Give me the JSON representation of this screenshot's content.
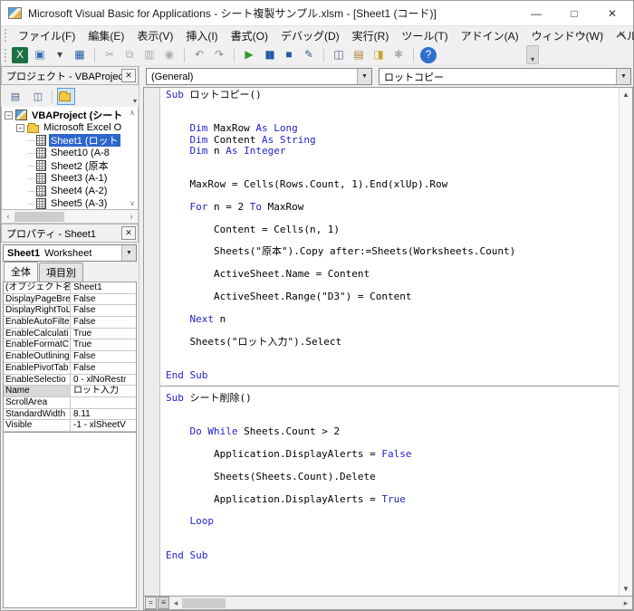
{
  "titlebar": {
    "title": "Microsoft Visual Basic for Applications - シート複製サンプル.xlsm - [Sheet1 (コード)]"
  },
  "menubar": {
    "items": [
      "ファイル(F)",
      "編集(E)",
      "表示(V)",
      "挿入(I)",
      "書式(O)",
      "デバッグ(D)",
      "実行(R)",
      "ツール(T)",
      "アドイン(A)",
      "ウィンドウ(W)",
      "ヘルプ(H)"
    ]
  },
  "toolbar": {
    "buttons": [
      {
        "name": "view-excel",
        "glyph": "X",
        "fg": "#ffffff",
        "bg": "#1d7044"
      },
      {
        "name": "insert-userform",
        "glyph": "▣",
        "fg": "#3b6bb5"
      },
      {
        "name": "insert-dropdown",
        "glyph": "▾",
        "fg": "#444444"
      },
      {
        "name": "save",
        "glyph": "▦",
        "fg": "#2456a8"
      },
      {
        "name": "separator"
      },
      {
        "name": "cut",
        "glyph": "✂",
        "fg": "#9a9a9a",
        "disabled": true
      },
      {
        "name": "copy",
        "glyph": "⧉",
        "fg": "#9a9a9a",
        "disabled": true
      },
      {
        "name": "paste",
        "glyph": "▥",
        "fg": "#9a9a9a",
        "disabled": true
      },
      {
        "name": "find",
        "glyph": "◉",
        "fg": "#9a9a9a",
        "disabled": true
      },
      {
        "name": "separator"
      },
      {
        "name": "undo",
        "glyph": "↶",
        "fg": "#8a8a8a"
      },
      {
        "name": "redo",
        "glyph": "↷",
        "fg": "#8a8a8a"
      },
      {
        "name": "separator"
      },
      {
        "name": "run",
        "glyph": "▶",
        "fg": "#2d9a2d"
      },
      {
        "name": "break",
        "glyph": "▮▮",
        "fg": "#2456a8"
      },
      {
        "name": "reset",
        "glyph": "■",
        "fg": "#2456a8"
      },
      {
        "name": "design-mode",
        "glyph": "✎",
        "fg": "#46628c"
      },
      {
        "name": "separator"
      },
      {
        "name": "project-explorer",
        "glyph": "◫",
        "fg": "#46628c"
      },
      {
        "name": "properties-window",
        "glyph": "▤",
        "fg": "#b07a3c"
      },
      {
        "name": "object-browser",
        "glyph": "◨",
        "fg": "#c9a227"
      },
      {
        "name": "toolbox",
        "glyph": "✱",
        "fg": "#9a9a9a",
        "disabled": true
      },
      {
        "name": "separator"
      },
      {
        "name": "help",
        "glyph": "?",
        "fg": "#ffffff",
        "bg": "#2f6fd0",
        "round": true
      }
    ]
  },
  "project": {
    "caption": "プロジェクト - VBAProject",
    "toolbar": [
      {
        "name": "view-code",
        "glyph": "▤",
        "fg": "#46628c"
      },
      {
        "name": "view-object",
        "glyph": "◫",
        "fg": "#46628c"
      },
      {
        "name": "separator"
      },
      {
        "name": "toggle-folders",
        "css": "folder",
        "pressed": true
      }
    ],
    "tree": [
      {
        "label": "VBAProject (シート",
        "level": 0,
        "bold": true,
        "expander": true,
        "icon": "vbaproject"
      },
      {
        "label": "Microsoft Excel O",
        "level": 1,
        "expander": true,
        "icon": "folder"
      },
      {
        "label": "Sheet1 (ロット",
        "level": 2,
        "icon": "sheet",
        "selected": true
      },
      {
        "label": "Sheet10 (A-8",
        "level": 2,
        "icon": "sheet"
      },
      {
        "label": "Sheet2 (原本",
        "level": 2,
        "icon": "sheet"
      },
      {
        "label": "Sheet3 (A-1)",
        "level": 2,
        "icon": "sheet"
      },
      {
        "label": "Sheet4 (A-2)",
        "level": 2,
        "icon": "sheet"
      },
      {
        "label": "Sheet5 (A-3)",
        "level": 2,
        "icon": "sheet"
      }
    ]
  },
  "properties": {
    "caption": "プロパティ - Sheet1",
    "object": {
      "name": "Sheet1",
      "type": "Worksheet"
    },
    "tabs": [
      "全体",
      "項目別"
    ],
    "active_tab": "全体",
    "rows": [
      {
        "label": "(オブジェクト名)",
        "value": "Sheet1"
      },
      {
        "label": "DisplayPageBre",
        "value": "False"
      },
      {
        "label": "DisplayRightToL",
        "value": "False"
      },
      {
        "label": "EnableAutoFilte",
        "value": "False"
      },
      {
        "label": "EnableCalculati",
        "value": "True"
      },
      {
        "label": "EnableFormatC",
        "value": "True"
      },
      {
        "label": "EnableOutlining",
        "value": "False"
      },
      {
        "label": "EnablePivotTab",
        "value": "False"
      },
      {
        "label": "EnableSelectio",
        "value": "0 - xlNoRestr"
      },
      {
        "label": "Name",
        "value": "ロット入力",
        "selected": true
      },
      {
        "label": "ScrollArea",
        "value": ""
      },
      {
        "label": "StandardWidth",
        "value": "8.11"
      },
      {
        "label": "Visible",
        "value": "-1 - xlSheetV"
      }
    ]
  },
  "code_window": {
    "object_dropdown": "(General)",
    "procedure_dropdown": "ロットコピー",
    "blocks": [
      {
        "lines": [
          [
            [
              "Sub",
              "k"
            ],
            [
              " ロットコピー()",
              "t"
            ]
          ],
          [],
          [],
          [
            [
              "    ",
              "t"
            ],
            [
              "Dim",
              "k"
            ],
            [
              " MaxRow ",
              "t"
            ],
            [
              "As",
              "k"
            ],
            [
              " ",
              "t"
            ],
            [
              "Long",
              "k"
            ]
          ],
          [
            [
              "    ",
              "t"
            ],
            [
              "Dim",
              "k"
            ],
            [
              " Content ",
              "t"
            ],
            [
              "As",
              "k"
            ],
            [
              " ",
              "t"
            ],
            [
              "String",
              "k"
            ]
          ],
          [
            [
              "    ",
              "t"
            ],
            [
              "Dim",
              "k"
            ],
            [
              " n ",
              "t"
            ],
            [
              "As",
              "k"
            ],
            [
              " ",
              "t"
            ],
            [
              "Integer",
              "k"
            ]
          ],
          [],
          [],
          [
            [
              "    MaxRow = Cells(Rows.Count, 1).End(xlUp).Row",
              "t"
            ]
          ],
          [],
          [
            [
              "    ",
              "t"
            ],
            [
              "For",
              "k"
            ],
            [
              " n = 2 ",
              "t"
            ],
            [
              "To",
              "k"
            ],
            [
              " MaxRow",
              "t"
            ]
          ],
          [],
          [
            [
              "        Content = Cells(n, 1)",
              "t"
            ]
          ],
          [],
          [
            [
              "        Sheets(\"原本\").Copy after:=Sheets(Worksheets.Count)",
              "t"
            ]
          ],
          [],
          [
            [
              "        ActiveSheet.Name = Content",
              "t"
            ]
          ],
          [],
          [
            [
              "        ActiveSheet.Range(\"D3\") = Content",
              "t"
            ]
          ],
          [],
          [
            [
              "    ",
              "t"
            ],
            [
              "Next",
              "k"
            ],
            [
              " n",
              "t"
            ]
          ],
          [],
          [
            [
              "    Sheets(\"ロット入力\").Select",
              "t"
            ]
          ],
          [],
          [],
          [
            [
              "End Sub",
              "k"
            ]
          ]
        ]
      },
      {
        "lines": [
          [
            [
              "Sub",
              "k"
            ],
            [
              " シート削除()",
              "t"
            ]
          ],
          [],
          [],
          [
            [
              "    ",
              "t"
            ],
            [
              "Do While",
              "k"
            ],
            [
              " Sheets.Count > 2",
              "t"
            ]
          ],
          [],
          [
            [
              "        Application.DisplayAlerts = ",
              "t"
            ],
            [
              "False",
              "k"
            ]
          ],
          [],
          [
            [
              "        Sheets(Sheets.Count).Delete",
              "t"
            ]
          ],
          [],
          [
            [
              "        Application.DisplayAlerts = ",
              "t"
            ],
            [
              "True",
              "k"
            ]
          ],
          [],
          [
            [
              "    ",
              "t"
            ],
            [
              "Loop",
              "k"
            ]
          ],
          [],
          [],
          [
            [
              "End Sub",
              "k"
            ]
          ]
        ]
      }
    ]
  },
  "icons": {
    "minimize": "—",
    "maximize": "□",
    "close": "✕",
    "mdi_minimize": "–",
    "mdi_restore": "▫",
    "mdi_close": "✕",
    "overflow": "▾",
    "dropdown": "▼",
    "scroll_up": "▲",
    "scroll_down": "▼",
    "scroll_left": "◂",
    "scroll_right": "▸",
    "tree_scroll_up": "∧",
    "tree_scroll_down": "∨",
    "tree_scroll_left": "‹",
    "tree_scroll_right": "›",
    "expander_collapse": "−",
    "split_procedure": "=",
    "split_full_module": "≡"
  },
  "colors": {
    "keyword": "#2323cc",
    "selection_bg": "#2e66c9",
    "selection_fg": "#ffffff",
    "run_green": "#2d9a2d",
    "help_blue": "#2f6fd0",
    "excel_green": "#1d7044"
  }
}
